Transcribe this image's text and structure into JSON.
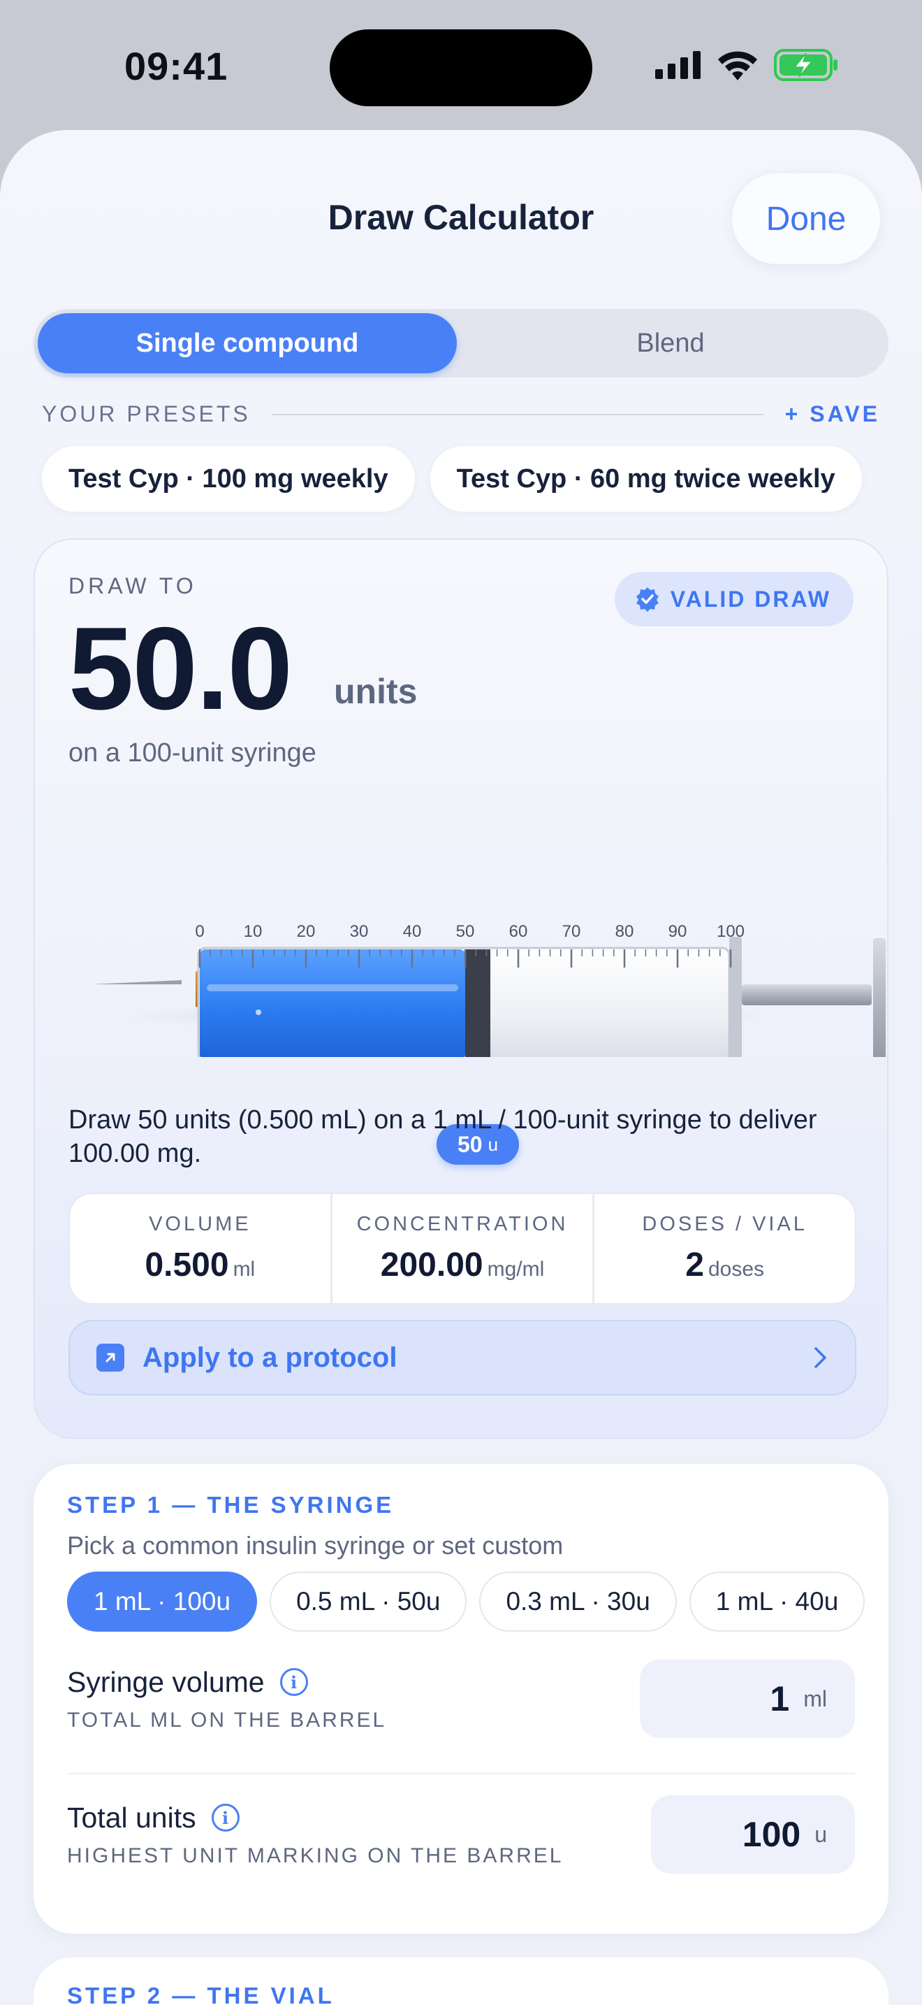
{
  "status_bar": {
    "time": "09:41"
  },
  "header": {
    "title": "Draw Calculator",
    "done_label": "Done"
  },
  "segmented": {
    "options": [
      "Single compound",
      "Blend"
    ],
    "selected": "Single compound"
  },
  "presets": {
    "label": "YOUR PRESETS",
    "save_label": "+ SAVE",
    "items": [
      "Test Cyp · 100 mg weekly",
      "Test Cyp · 60 mg twice weekly"
    ]
  },
  "result": {
    "draw_to_label": "DRAW TO",
    "badge": "VALID DRAW",
    "value": "50.0",
    "unit": "units",
    "syringe_caption": "on a 100-unit syringe",
    "syringe_ticks": [
      "0",
      "10",
      "20",
      "30",
      "40",
      "50",
      "60",
      "70",
      "80",
      "90",
      "100"
    ],
    "fill_units": 50,
    "total_units": 100,
    "marker_value": "50",
    "marker_unit": "u",
    "explanation": "Draw 50 units (0.500 mL) on a 1 mL / 100-unit syringe to deliver 100.00 mg.",
    "stats": [
      {
        "label": "VOLUME",
        "value": "0.500",
        "unit": "ml"
      },
      {
        "label": "CONCENTRATION",
        "value": "200.00",
        "unit": "mg/ml"
      },
      {
        "label": "DOSES / VIAL",
        "value": "2",
        "unit": "doses"
      }
    ],
    "apply_label": "Apply to a protocol"
  },
  "step1": {
    "title": "STEP 1 — THE SYRINGE",
    "subtitle": "Pick a common insulin syringe or set custom",
    "syringe_options": [
      "1 mL · 100u",
      "0.5 mL · 50u",
      "0.3 mL · 30u",
      "1 mL · 40u"
    ],
    "selected_option": "1 mL · 100u",
    "syringe_volume": {
      "label": "Syringe volume",
      "caption": "TOTAL ML ON THE BARREL",
      "value": "1",
      "unit": "ml"
    },
    "total_units": {
      "label": "Total units",
      "caption": "HIGHEST UNIT MARKING ON THE BARREL",
      "value": "100",
      "unit": "u"
    }
  },
  "step2": {
    "title": "STEP 2 — THE VIAL"
  },
  "colors": {
    "accent": "#4a80f6",
    "ink": "#17223b",
    "muted": "#5e6780",
    "badge_bg": "#dce5fb"
  }
}
